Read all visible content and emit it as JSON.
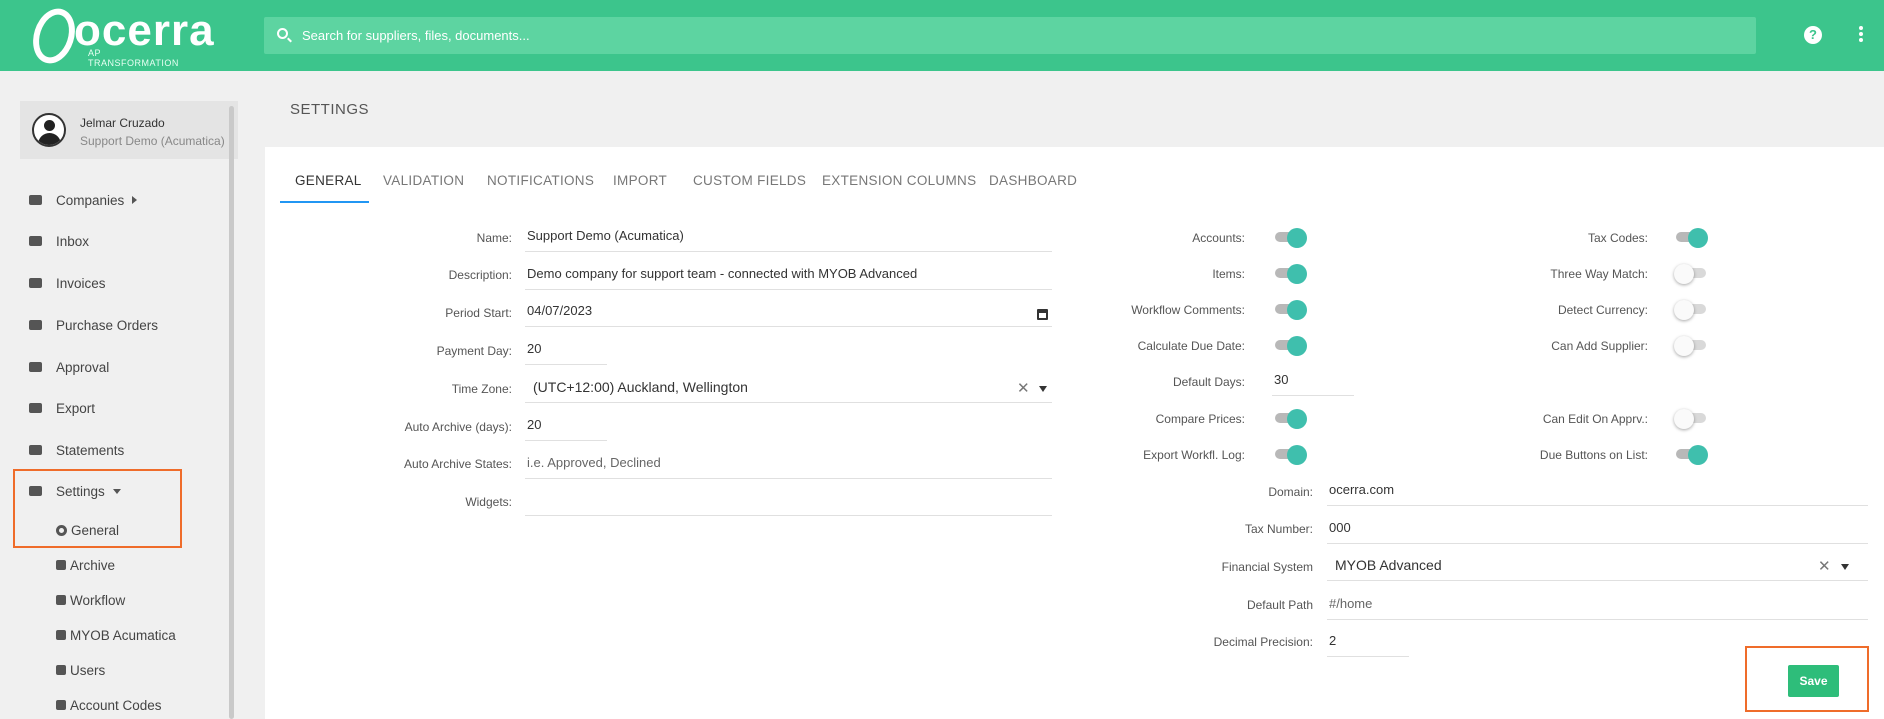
{
  "header": {
    "logo_text": "ocerra",
    "logo_tagline": "AP TRANSFORMATION",
    "search_placeholder": "Search for suppliers, files, documents...",
    "help_glyph": "?"
  },
  "sidebar": {
    "user": {
      "name": "Jelmar Cruzado",
      "org": "Support Demo (Acumatica)"
    },
    "items": [
      {
        "label": "Companies",
        "icon": "id-card-icon"
      },
      {
        "label": "Inbox",
        "icon": "inbox-icon"
      },
      {
        "label": "Invoices",
        "icon": "basket-icon"
      },
      {
        "label": "Purchase Orders",
        "icon": "cart-icon"
      },
      {
        "label": "Approval",
        "icon": "handshake-icon"
      },
      {
        "label": "Export",
        "icon": "external-link-icon"
      },
      {
        "label": "Statements",
        "icon": "basket-icon"
      },
      {
        "label": "Settings",
        "icon": "gear-icon"
      }
    ],
    "sub_items": [
      {
        "label": "General",
        "icon": "gear-icon"
      },
      {
        "label": "Archive",
        "icon": "archive-icon"
      },
      {
        "label": "Workflow",
        "icon": "flow-icon"
      },
      {
        "label": "MYOB Acumatica",
        "icon": "puzzle-icon"
      },
      {
        "label": "Users",
        "icon": "users-icon"
      },
      {
        "label": "Account Codes",
        "icon": "clipboard-icon"
      }
    ]
  },
  "main": {
    "title": "SETTINGS",
    "tabs": [
      "GENERAL",
      "VALIDATION",
      "NOTIFICATIONS",
      "IMPORT",
      "CUSTOM FIELDS",
      "EXTENSION COLUMNS",
      "DASHBOARD"
    ],
    "active_tab": "GENERAL",
    "form_left": {
      "name": {
        "label": "Name:",
        "value": "Support Demo (Acumatica)"
      },
      "description": {
        "label": "Description:",
        "value": "Demo company for support team - connected with MYOB Advanced"
      },
      "period_start": {
        "label": "Period Start:",
        "value": "04/07/2023"
      },
      "payment_day": {
        "label": "Payment Day:",
        "value": "20"
      },
      "time_zone": {
        "label": "Time Zone:",
        "value": "(UTC+12:00) Auckland, Wellington"
      },
      "auto_archive_days": {
        "label": "Auto Archive (days):",
        "value": "20"
      },
      "auto_archive_states": {
        "label": "Auto Archive States:",
        "placeholder": "i.e. Approved, Declined"
      },
      "widgets": {
        "label": "Widgets:",
        "value": ""
      }
    },
    "toggles_mid": [
      {
        "label": "Accounts:",
        "on": true
      },
      {
        "label": "Items:",
        "on": true
      },
      {
        "label": "Workflow Comments:",
        "on": true
      },
      {
        "label": "Calculate Due Date:",
        "on": true
      }
    ],
    "default_days": {
      "label": "Default Days:",
      "value": "30"
    },
    "toggles_mid2": [
      {
        "label": "Compare Prices:",
        "on": true
      },
      {
        "label": "Export Workfl. Log:",
        "on": true
      }
    ],
    "toggles_right": [
      {
        "label": "Tax Codes:",
        "on": true
      },
      {
        "label": "Three Way Match:",
        "on": false
      },
      {
        "label": "Detect Currency:",
        "on": false
      },
      {
        "label": "Can Add Supplier:",
        "on": false
      }
    ],
    "toggles_right2": [
      {
        "label": "Can Edit On Apprv.:",
        "on": false
      },
      {
        "label": "Due Buttons on List:",
        "on": true
      }
    ],
    "form_right": {
      "domain": {
        "label": "Domain:",
        "value": "ocerra.com"
      },
      "tax_number": {
        "label": "Tax Number:",
        "value": "000"
      },
      "financial_system": {
        "label": "Financial System",
        "value": "MYOB Advanced"
      },
      "default_path": {
        "label": "Default Path",
        "placeholder": "#/home"
      },
      "decimal_precision": {
        "label": "Decimal Precision:",
        "value": "2"
      }
    },
    "save_label": "Save"
  },
  "colors": {
    "brand": "#3cc58c",
    "toggle_on": "#3fbfad",
    "highlight": "#ef6c2a",
    "tab_active": "#2196f3"
  }
}
